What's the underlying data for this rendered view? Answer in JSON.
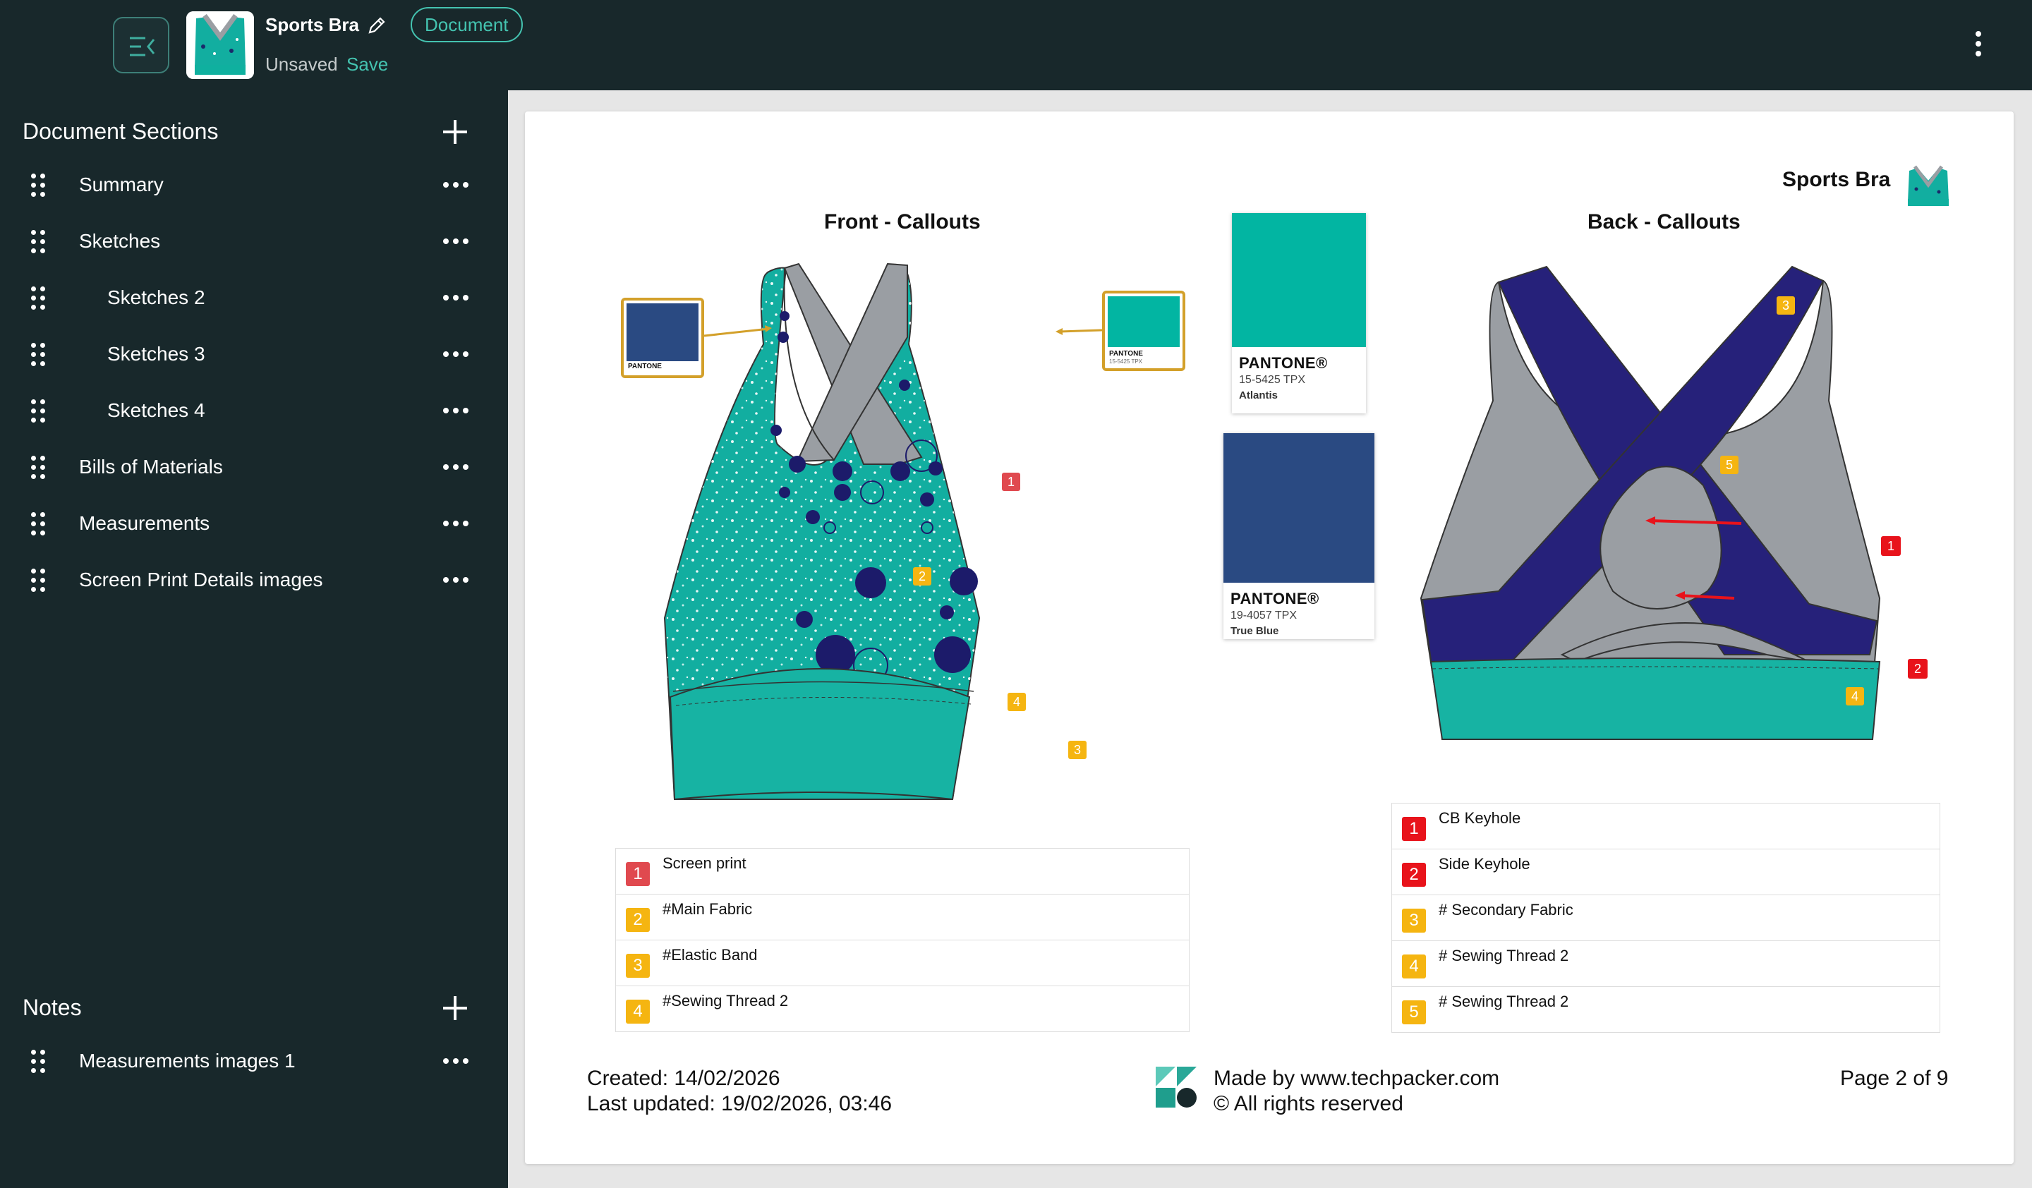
{
  "header": {
    "doc_title": "Sports Bra",
    "badge": "Document",
    "status": "Unsaved",
    "save_label": "Save"
  },
  "sidebar": {
    "sections_title": "Document Sections",
    "sections": [
      {
        "label": "Summary"
      },
      {
        "label": "Sketches"
      },
      {
        "label": "Sketches 2"
      },
      {
        "label": "Sketches 3"
      },
      {
        "label": "Sketches 4"
      },
      {
        "label": "Bills of Materials"
      },
      {
        "label": "Measurements"
      },
      {
        "label": "Screen Print Details images"
      }
    ],
    "notes_title": "Notes",
    "notes": [
      {
        "label": "Measurements images 1"
      }
    ]
  },
  "page": {
    "brand": "Sports Bra",
    "front_title": "Front - Callouts",
    "back_title": "Back - Callouts",
    "pantones": [
      {
        "brand": "PANTONE",
        "code": "15-5425 TPX",
        "name": "Atlantis",
        "color": "#02b5a2"
      },
      {
        "brand": "PANTONE",
        "code": "19-4057 TPX",
        "name": "True Blue",
        "color": "#2a4a82"
      }
    ],
    "mini_pantone_label": "PANTONE",
    "mini_pantone_code": "15-5425 TPX",
    "front_callouts": [
      {
        "num": "1",
        "text": "Screen print",
        "color": "#e0494f"
      },
      {
        "num": "2",
        "text": "#Main Fabric",
        "color": "#f5b511"
      },
      {
        "num": "3",
        "text": "#Elastic Band",
        "color": "#f5b511"
      },
      {
        "num": "4",
        "text": "#Sewing Thread 2",
        "color": "#f5b511"
      }
    ],
    "back_callouts": [
      {
        "num": "1",
        "text": "CB Keyhole",
        "color": "#e8131b"
      },
      {
        "num": "2",
        "text": "Side Keyhole",
        "color": "#e8131b"
      },
      {
        "num": "3",
        "text": "# Secondary Fabric",
        "color": "#f5b511"
      },
      {
        "num": "4",
        "text": "# Sewing Thread 2",
        "color": "#f5b511"
      },
      {
        "num": "5",
        "text": "# Sewing Thread 2",
        "color": "#f5b511"
      }
    ],
    "front_markers": [
      "1",
      "2",
      "3",
      "4"
    ],
    "back_markers": [
      "1",
      "2",
      "3",
      "4",
      "5"
    ],
    "footer": {
      "created": "Created: 14/02/2026",
      "updated": "Last updated: 19/02/2026, 03:46",
      "made_by": "Made by www.techpacker.com",
      "rights": "© All rights reserved",
      "page_num": "Page 2 of 9"
    }
  },
  "colors": {
    "sidebar_bg": "#18282b",
    "accent": "#44c3b0",
    "teal_fabric": "#12aea0",
    "navy": "#26217a",
    "grey_strap": "#9a9ea3"
  }
}
